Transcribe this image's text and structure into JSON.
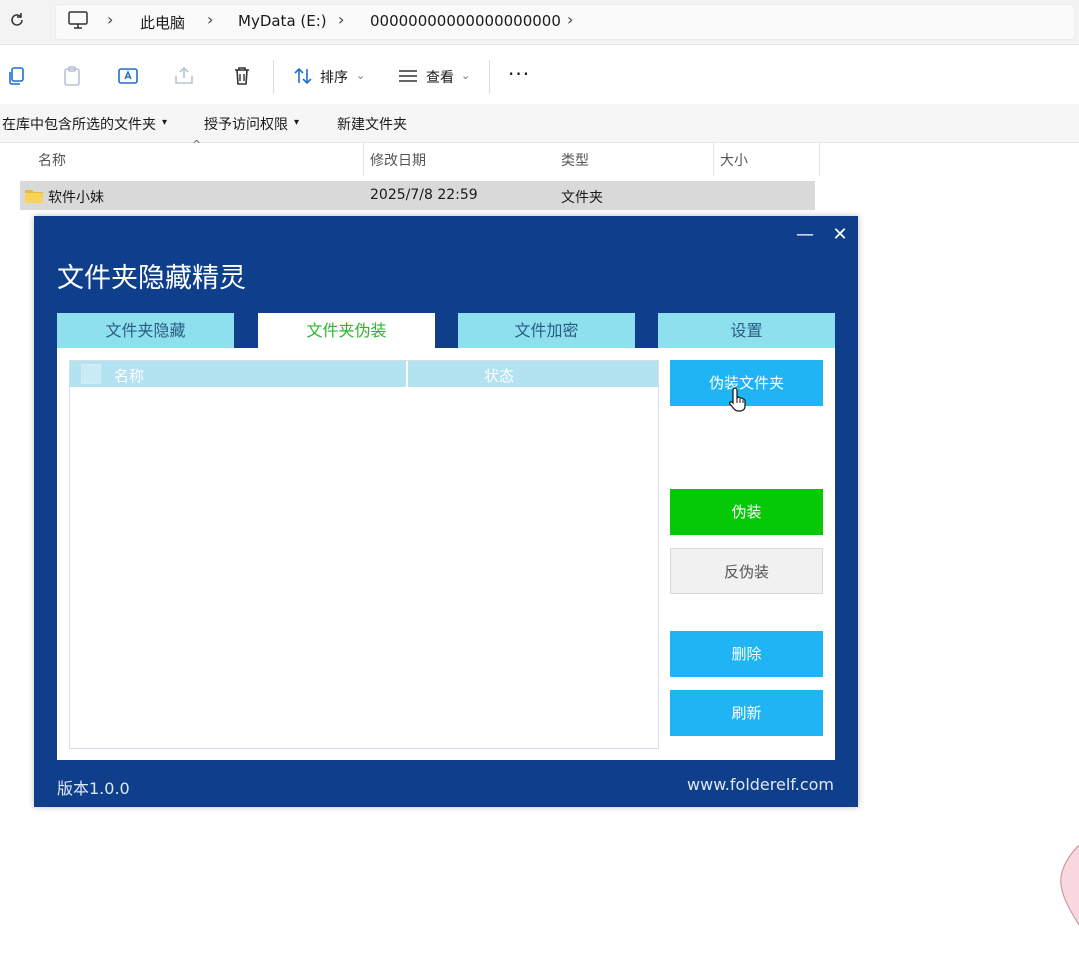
{
  "explorer": {
    "breadcrumb": [
      "此电脑",
      "MyData (E:)",
      "00000000000000000000"
    ],
    "commands": {
      "sort": "排序",
      "view": "查看"
    },
    "library": [
      "在库中包含所选的文件夹",
      "授予访问权限",
      "新建文件夹"
    ],
    "columns": [
      "名称",
      "修改日期",
      "类型",
      "大小"
    ],
    "row": {
      "name": "软件小妹",
      "modified": "2025/7/8 22:59",
      "type": "文件夹"
    }
  },
  "app": {
    "title": "文件夹隐藏精灵",
    "tabs": [
      "文件夹隐藏",
      "文件夹伪装",
      "文件加密",
      "设置"
    ],
    "active_tab": 1,
    "list_headers": [
      "名称",
      "状态"
    ],
    "buttons": {
      "disguise_folder": "伪装文件夹",
      "disguise": "伪装",
      "undisguise": "反伪装",
      "delete": "删除",
      "refresh": "刷新"
    },
    "version": "版本1.0.0",
    "website": "www.folderelf.com"
  },
  "colors": {
    "app_bg": "#0f3e8b",
    "tab_bg": "#8ee0ef",
    "accent_blue": "#1fb4f3",
    "accent_green": "#06c906"
  },
  "icons": [
    "refresh-icon",
    "computer-icon",
    "copy-icon",
    "paste-icon",
    "rename-icon",
    "share-icon",
    "delete-icon",
    "sort-icon",
    "view-icon",
    "more-icon",
    "folder-icon",
    "minimize-icon",
    "close-icon",
    "hand-cursor-icon"
  ]
}
